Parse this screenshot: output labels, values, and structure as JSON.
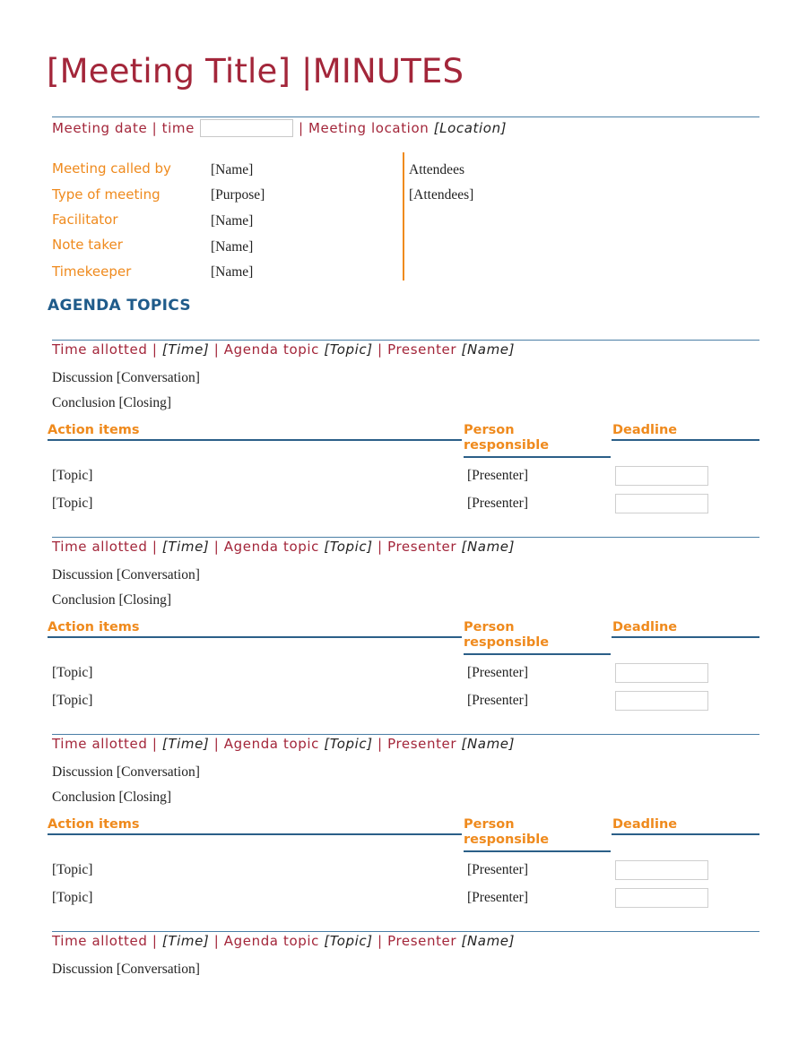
{
  "document": {
    "title": "[Meeting Title] |MINUTES",
    "meeting_line": {
      "date_time_label": "Meeting date | time",
      "date_time_value": "",
      "location_label": "| Meeting location",
      "location_value": "[Location]"
    },
    "details": [
      {
        "label": "Meeting called by",
        "value": "[Name]"
      },
      {
        "label": "Type of meeting",
        "value": "[Purpose]"
      },
      {
        "label": "Facilitator",
        "value": "[Name]"
      },
      {
        "label": "Note taker",
        "value": "[Name]"
      },
      {
        "label": "Timekeeper",
        "value": "[Name]"
      }
    ],
    "attendees": {
      "label": "Attendees",
      "value": "[Attendees]"
    },
    "agenda_heading": "AGENDA TOPICS",
    "topic_labels": {
      "time_allotted": "Time allotted |",
      "agenda_topic": "| Agenda topic",
      "presenter": "| Presenter"
    },
    "action_headers": {
      "action_items": "Action items",
      "person_line1": "Person",
      "person_line2": "responsible",
      "deadline": "Deadline"
    },
    "topics": [
      {
        "time": "[Time]",
        "topic": "[Topic]",
        "presenter": "[Name]",
        "discussion": "Discussion [Conversation]",
        "conclusion": "Conclusion [Closing]",
        "actions": [
          {
            "item": "[Topic]",
            "person": "[Presenter]",
            "deadline": ""
          },
          {
            "item": "[Topic]",
            "person": "[Presenter]",
            "deadline": ""
          }
        ]
      },
      {
        "time": "[Time]",
        "topic": "[Topic]",
        "presenter": "[Name]",
        "discussion": "Discussion [Conversation]",
        "conclusion": "Conclusion [Closing]",
        "actions": [
          {
            "item": "[Topic]",
            "person": "[Presenter]",
            "deadline": ""
          },
          {
            "item": "[Topic]",
            "person": "[Presenter]",
            "deadline": ""
          }
        ]
      },
      {
        "time": "[Time]",
        "topic": "[Topic]",
        "presenter": "[Name]",
        "discussion": "Discussion [Conversation]",
        "conclusion": "Conclusion [Closing]",
        "actions": [
          {
            "item": "[Topic]",
            "person": "[Presenter]",
            "deadline": ""
          },
          {
            "item": "[Topic]",
            "person": "[Presenter]",
            "deadline": ""
          }
        ]
      },
      {
        "time": "[Time]",
        "topic": "[Topic]",
        "presenter": "[Name]",
        "discussion": "Discussion [Conversation]"
      }
    ],
    "colors": {
      "title": "#a3263a",
      "label_orange": "#ef8a1d",
      "heading_blue": "#1f5b8a",
      "rule_blue": "#2b5f88"
    }
  }
}
